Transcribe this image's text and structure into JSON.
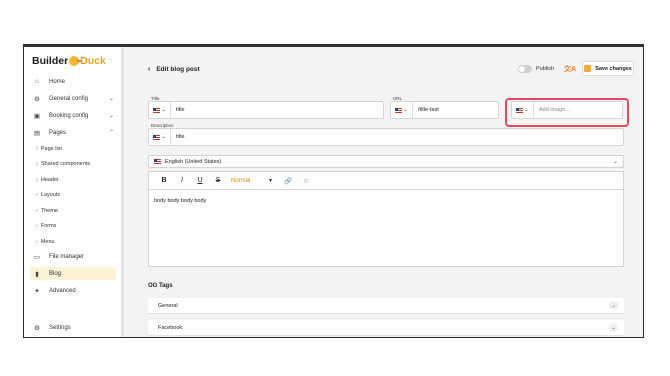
{
  "sidebar": {
    "logo_builder": "Builder",
    "logo_duck": "Duck",
    "collapse_glyph": "‹",
    "items": [
      {
        "label": "Home",
        "icon": "home-icon",
        "glyph": "⌂"
      },
      {
        "label": "General config",
        "icon": "gear-icon",
        "glyph": "⚙",
        "chevron": "⌄"
      },
      {
        "label": "Booking config",
        "icon": "calendar-icon",
        "glyph": "▣",
        "chevron": "⌄"
      },
      {
        "label": "Pages",
        "icon": "pages-icon",
        "glyph": "▤",
        "chevron": "⌃"
      },
      {
        "label": "File manager",
        "icon": "folder-icon",
        "glyph": "▭"
      },
      {
        "label": "Blog",
        "icon": "document-icon",
        "glyph": "▮"
      },
      {
        "label": "Advanced",
        "icon": "rocket-icon",
        "glyph": "✦"
      },
      {
        "label": "Settings",
        "icon": "gear-icon",
        "glyph": "⚙"
      }
    ],
    "sub_items": [
      "Page list",
      "Shared components",
      "Header",
      "Layouts",
      "Theme",
      "Forms",
      "Menu"
    ],
    "sub_arrow": "›"
  },
  "header": {
    "back_glyph": "‹",
    "title": "Edit blog post",
    "publish_label": "Publish",
    "translate_glyph": "文A",
    "save_label": "Save changes"
  },
  "form": {
    "flag_chevron": "⌄",
    "title_label": "Title",
    "title_value": "title",
    "url_label": "URL",
    "url_value": "/title-test",
    "image_placeholder": "Add image...",
    "description_label": "Description",
    "description_value": "title",
    "language": "English (United States)",
    "language_chevron": "⌄"
  },
  "toolbar": {
    "bold": "B",
    "italic": "I",
    "underline": "U",
    "strike": "S",
    "heading": "Normal",
    "heading_dropdown": "▼",
    "link_glyph": "🔗",
    "unlink_glyph": "⊘"
  },
  "editor": {
    "body": "body body body body"
  },
  "og": {
    "title": "OG Tags",
    "sections": [
      "General",
      "Facebook"
    ],
    "chevron": "⌄"
  },
  "colors": {
    "accent": "#f2a93b",
    "highlight": "#e64a5a",
    "active_nav": "#fdf1d6"
  }
}
